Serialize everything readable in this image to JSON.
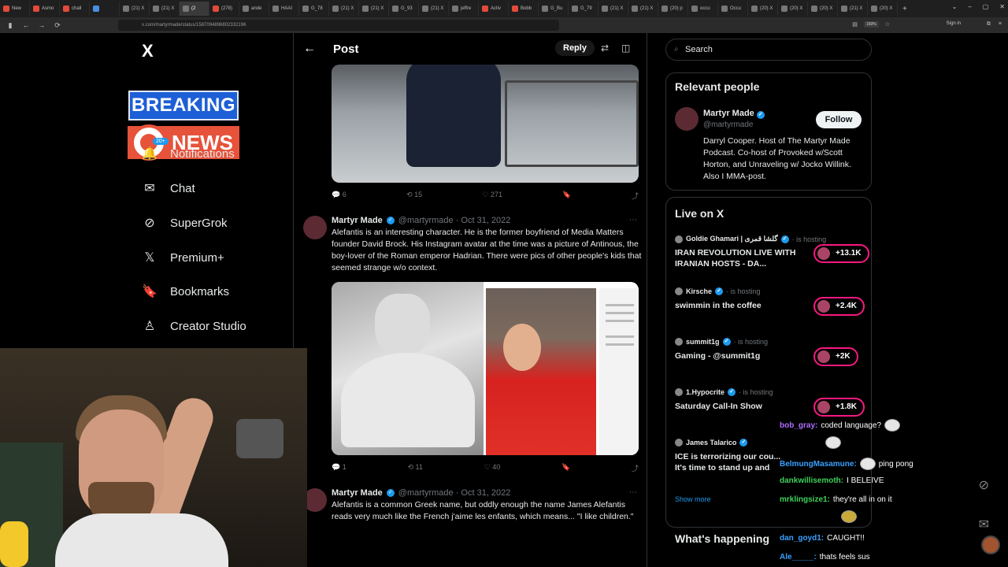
{
  "browser": {
    "tabs": [
      {
        "label": "New",
        "favicon": "red"
      },
      {
        "label": "Asmo",
        "favicon": "red"
      },
      {
        "label": "chall",
        "favicon": "red"
      },
      {
        "label": "",
        "favicon": "blue"
      },
      {
        "label": "(21) X",
        "favicon": "gray"
      },
      {
        "label": "(21) X",
        "favicon": "gray"
      },
      {
        "label": "(2",
        "favicon": "gray",
        "active": true
      },
      {
        "label": "(278)",
        "favicon": "red"
      },
      {
        "label": "ande",
        "favicon": "gray"
      },
      {
        "label": "HAAI",
        "favicon": "gray"
      },
      {
        "label": "G_78",
        "favicon": "gray"
      },
      {
        "label": "(21) X",
        "favicon": "gray"
      },
      {
        "label": "(21) X",
        "favicon": "gray"
      },
      {
        "label": "G_93",
        "favicon": "gray"
      },
      {
        "label": "(21) X",
        "favicon": "gray"
      },
      {
        "label": "jeffre",
        "favicon": "gray"
      },
      {
        "label": "Activ",
        "favicon": "red"
      },
      {
        "label": "Bobb",
        "favicon": "red"
      },
      {
        "label": "G_Bu",
        "favicon": "gray"
      },
      {
        "label": "G_79",
        "favicon": "gray"
      },
      {
        "label": "(21) X",
        "favicon": "gray"
      },
      {
        "label": "(21) X",
        "favicon": "gray"
      },
      {
        "label": "(20) p",
        "favicon": "gray"
      },
      {
        "label": "occu",
        "favicon": "gray"
      },
      {
        "label": "Occu",
        "favicon": "gray"
      },
      {
        "label": "(20) X",
        "favicon": "gray"
      },
      {
        "label": "(20) X",
        "favicon": "gray"
      },
      {
        "label": "(20) X",
        "favicon": "gray"
      },
      {
        "label": "(21) X",
        "favicon": "gray"
      },
      {
        "label": "(20) X",
        "favicon": "gray"
      }
    ],
    "new_tab": "+",
    "window_controls": [
      "⌄",
      "–",
      "▢",
      "✕"
    ],
    "url": "x.com/martyrmade/status/1587094896802332196",
    "zoom": "150%",
    "signin": "Sign in"
  },
  "leftnav": {
    "logo": "X",
    "breaking": "BREAKING",
    "news": "NEWS",
    "notif_badge": "20+",
    "items": [
      {
        "label": "Notifications",
        "icon": "bell-icon",
        "glyph": "🔔"
      },
      {
        "label": "Chat",
        "icon": "mail-icon",
        "glyph": "✉"
      },
      {
        "label": "SuperGrok",
        "icon": "grok-icon",
        "glyph": "⊘"
      },
      {
        "label": "Premium+",
        "icon": "x-icon",
        "glyph": "𝕏"
      },
      {
        "label": "Bookmarks",
        "icon": "bookmark-icon",
        "glyph": "🔖"
      },
      {
        "label": "Creator Studio",
        "icon": "creator-icon",
        "glyph": "♙"
      }
    ]
  },
  "post": {
    "back": "←",
    "title": "Post",
    "reply_button": "Reply",
    "actions1": [
      "💬 6",
      "⟲ 15",
      "♡ 271",
      "🔖",
      "⤴"
    ],
    "tweets": [
      {
        "name": "Martyr Made",
        "handle": "@martyrmade · Oct 31, 2022",
        "text": "Alefantis is an interesting character. He is the former boyfriend of Media Matters founder David Brock. His Instagram avatar at the time was a picture of Antinous, the boy-lover of the Roman emperor Hadrian. There were pics of other people's kids that seemed strange w/o context."
      },
      {
        "name": "Martyr Made",
        "handle": "@martyrmade · Oct 31, 2022",
        "text": "Alefantis is a common Greek name, but oddly enough the name James Alefantis reads very much like the French j'aime les enfants, which means... \"I like children.\""
      }
    ],
    "actions2": [
      "💬 1",
      "⟲ 11",
      "♡ 40",
      "🔖",
      "⤴"
    ]
  },
  "right": {
    "search_placeholder": "Search",
    "relevant_title": "Relevant people",
    "rp_name": "Martyr Made",
    "rp_handle": "@martyrmade",
    "follow": "Follow",
    "rp_bio": "Darryl Cooper. Host of The Martyr Made Podcast. Co-host of Provoked w/Scott Horton, and Unraveling w/ Jocko Willink. Also I MMA-post.",
    "live_title": "Live on X",
    "live": [
      {
        "host": "Goldie Ghamari | گلشا قمری",
        "meta": "· is hosting",
        "title": "IRAN REVOLUTION LIVE WITH IRANIAN HOSTS - DA...",
        "count": "+13.1K"
      },
      {
        "host": "Kirsche",
        "meta": "· is hosting",
        "title": "swimmin in the coffee",
        "count": "+2.4K"
      },
      {
        "host": "summit1g",
        "meta": "· is hosting",
        "title": "Gaming - @summit1g",
        "count": "+2K"
      },
      {
        "host": "1.Hypocrite",
        "meta": "· is hosting",
        "title": "Saturday Call-In Show",
        "count": "+1.8K"
      },
      {
        "host": "James Talarico",
        "meta": "",
        "title": "ICE is terrorizing our cou... It's time to stand up and",
        "count": ""
      }
    ],
    "show_more": "Show more",
    "happening": "What's happening"
  },
  "chat": [
    {
      "user": "bob_gray:",
      "msg": "coded language?",
      "color": "#b06cff"
    },
    {
      "user": "",
      "msg": "",
      "color": "#ccc"
    },
    {
      "user": "BelmungMasamune:",
      "msg": "ping pong",
      "color": "#3aa0ff"
    },
    {
      "user": "dankwillisemoth:",
      "msg": "I BELEIVE",
      "color": "#3fd15a"
    },
    {
      "user": "mrklingsize1:",
      "msg": "they're all in on it",
      "color": "#3fd15a"
    },
    {
      "user": "",
      "msg": "",
      "color": "#ccc"
    },
    {
      "user": "dan_goyd1:",
      "msg": "CAUGHT!!",
      "color": "#3aa0ff"
    },
    {
      "user": "Ale_____:",
      "msg": "thats feels sus",
      "color": "#3aa0ff"
    }
  ]
}
